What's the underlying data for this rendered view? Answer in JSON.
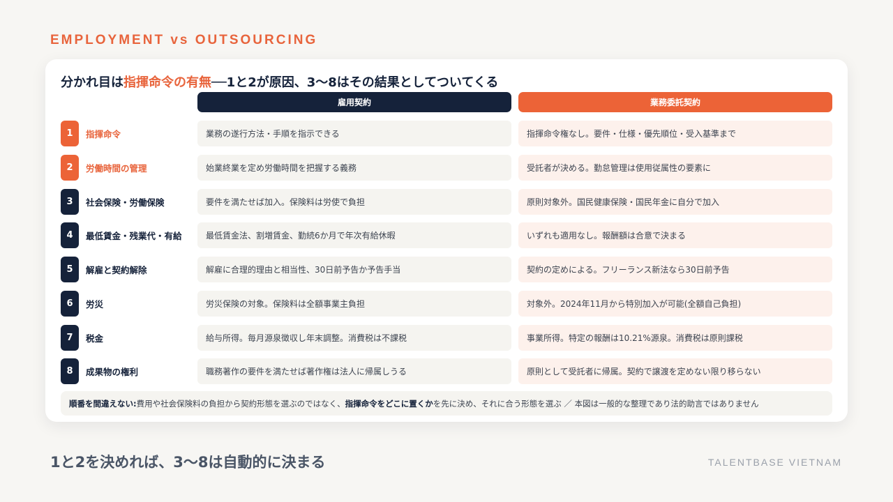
{
  "eyebrow": "EMPLOYMENT vs OUTSOURCING",
  "heading": {
    "prefix": "分かれ目は",
    "accent": "指揮命令の有無",
    "suffix": "──1と2が原因、3〜8はその結果としてついてくる"
  },
  "columns": {
    "employment": "雇用契約",
    "outsourcing": "業務委託契約"
  },
  "rows": [
    {
      "num": "1",
      "label": "指揮命令",
      "employment": "業務の遂行方法・手順を指示できる",
      "outsourcing": "指揮命令権なし。要件・仕様・優先順位・受入基準まで"
    },
    {
      "num": "2",
      "label": "労働時間の管理",
      "employment": "始業終業を定め労働時間を把握する義務",
      "outsourcing": "受託者が決める。勤怠管理は使用従属性の要素に"
    },
    {
      "num": "3",
      "label": "社会保険・労働保険",
      "employment": "要件を満たせば加入。保険料は労使で負担",
      "outsourcing": "原則対象外。国民健康保険・国民年金に自分で加入"
    },
    {
      "num": "4",
      "label": "最低賃金・残業代・有給",
      "employment": "最低賃金法、割増賃金、勤続6か月で年次有給休暇",
      "outsourcing": "いずれも適用なし。報酬額は合意で決まる"
    },
    {
      "num": "5",
      "label": "解雇と契約解除",
      "employment": "解雇に合理的理由と相当性、30日前予告か予告手当",
      "outsourcing": "契約の定めによる。フリーランス新法なら30日前予告"
    },
    {
      "num": "6",
      "label": "労災",
      "employment": "労災保険の対象。保険料は全額事業主負担",
      "outsourcing": "対象外。2024年11月から特別加入が可能(全額自己負担)"
    },
    {
      "num": "7",
      "label": "税金",
      "employment": "給与所得。毎月源泉徴収し年末調整。消費税は不課税",
      "outsourcing": "事業所得。特定の報酬は10.21%源泉。消費税は原則課税"
    },
    {
      "num": "8",
      "label": "成果物の権利",
      "employment": "職務著作の要件を満たせば著作権は法人に帰属しうる",
      "outsourcing": "原則として受託者に帰属。契約で譲渡を定めない限り移らない"
    }
  ],
  "note": {
    "lead": "順番を間違えない:",
    "part1": " 費用や社会保険料の負担から契約形態を選ぶのではなく、",
    "bold": "指揮命令をどこに置くか",
    "part2": "を先に決め、それに合う形態を選ぶ ／ 本図は一般的な整理であり法的助言ではありません"
  },
  "footer": {
    "title": "1と2を決めれば、3〜8は自動的に決まる",
    "brand": "TALENTBASE VIETNAM"
  },
  "colors": {
    "accent": "#ec6337",
    "navy": "#15223a",
    "background": "#f7f6f3"
  }
}
